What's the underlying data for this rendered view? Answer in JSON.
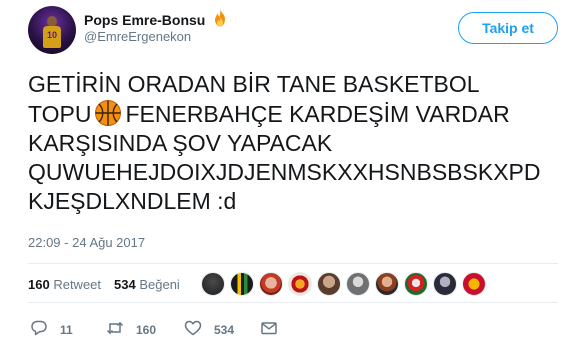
{
  "user": {
    "display_name": "Pops Emre-Bonsu",
    "handle": "@EmreErgenekon",
    "avatar_number": "10",
    "name_emoji": "fire-icon"
  },
  "follow_button": {
    "label": "Takip et"
  },
  "tweet": {
    "lines": [
      "GETİRİN ORADAN BİR TANE BASKETBOL",
      "TOPU",
      "FENERBAHÇE KARDEŞİM VARDAR",
      "KARŞISINDA ŞOV YAPACAK",
      "QUWUEHEJDOIXJDJENMSKXXHSNBSBSKXPD",
      "KJEŞDLXNDLEM :d"
    ],
    "inline_emoji": "basketball-icon",
    "timestamp": "22:09 - 24 Ağu 2017"
  },
  "stats": {
    "retweets_count": "160",
    "retweets_label": "Retweet",
    "likes_count": "534",
    "likes_label": "Beğeni"
  },
  "actions": {
    "reply_count": "11",
    "retweet_count": "160",
    "like_count": "534"
  },
  "colors": {
    "accent": "#1da1f2",
    "muted": "#657786",
    "text": "#14171a",
    "divider": "#e6ecf0"
  }
}
